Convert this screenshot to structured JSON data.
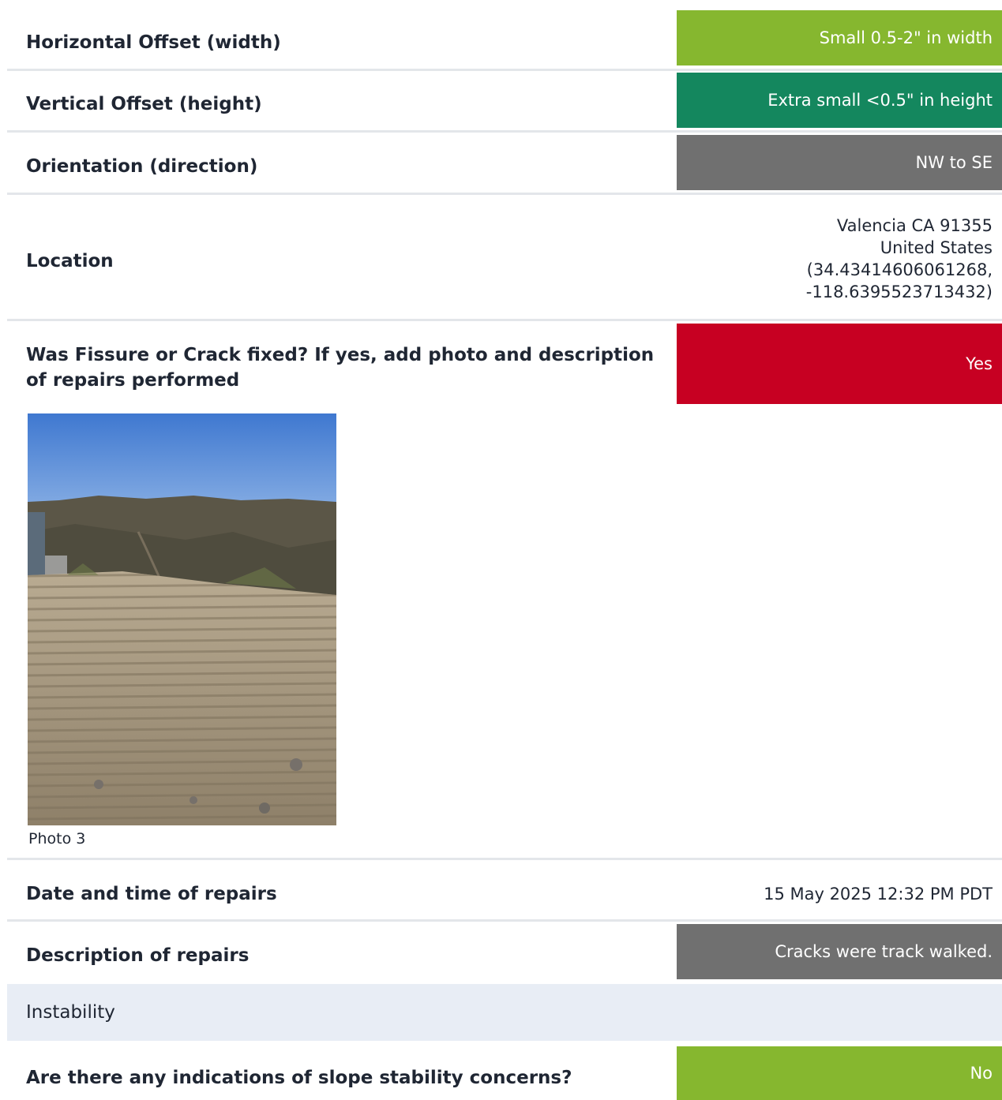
{
  "colors": {
    "green_light": "#86b72f",
    "green_dark": "#14875e",
    "gray": "#707070",
    "red": "#c70022",
    "section_bg": "#e8edf5",
    "divider": "#e3e6ea"
  },
  "rows": {
    "horizontal_offset": {
      "label": "Horizontal Offset (width)",
      "value": "Small 0.5-2\" in width"
    },
    "vertical_offset": {
      "label": "Vertical Offset (height)",
      "value": "Extra small <0.5\" in height"
    },
    "orientation": {
      "label": "Orientation (direction)",
      "value": "NW to SE"
    },
    "location": {
      "label": "Location",
      "line1": "Valencia CA 91355",
      "line2": "United States",
      "line3": "(34.43414606061268,",
      "line4": "-118.6395523713432)"
    },
    "fixed": {
      "label_line1": "Was Fissure or Crack fixed? If yes, add photo and description",
      "label_line2": "of repairs performed",
      "value": "Yes"
    },
    "photo": {
      "caption": "Photo 3"
    },
    "date_of_repairs": {
      "label": "Date and time of repairs",
      "value": "15 May 2025 12:32 PM PDT"
    },
    "description": {
      "label": "Description of repairs",
      "value": "Cracks were track walked."
    }
  },
  "section": {
    "title": "Instability"
  },
  "slope": {
    "label": "Are there any indications of slope stability concerns?",
    "value": "No"
  }
}
